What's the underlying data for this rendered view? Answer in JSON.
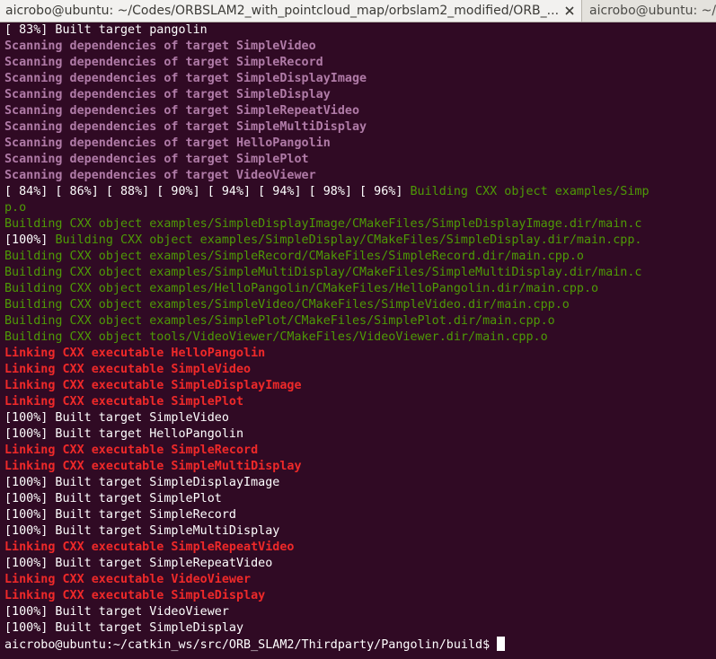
{
  "tabs": [
    {
      "title": "aicrobo@ubuntu: ~/Codes/ORBSLAM2_with_pointcloud_map/orbslam2_modified/ORB_...",
      "active": true
    },
    {
      "title": "aicrobo@ubuntu: ~/c",
      "active": false
    }
  ],
  "colors": {
    "background": "#300a24",
    "white": "#ffffff",
    "magenta": "#b07ba7",
    "green": "#4e9a06",
    "red": "#ef2929"
  },
  "lines": [
    {
      "segments": [
        {
          "text": "[ 83%] Built target pangolin",
          "color": "white"
        }
      ]
    },
    {
      "segments": [
        {
          "text": "Scanning dependencies of target SimpleVideo",
          "color": "magenta"
        }
      ]
    },
    {
      "segments": [
        {
          "text": "Scanning dependencies of target SimpleRecord",
          "color": "magenta"
        }
      ]
    },
    {
      "segments": [
        {
          "text": "Scanning dependencies of target SimpleDisplayImage",
          "color": "magenta"
        }
      ]
    },
    {
      "segments": [
        {
          "text": "Scanning dependencies of target SimpleDisplay",
          "color": "magenta"
        }
      ]
    },
    {
      "segments": [
        {
          "text": "Scanning dependencies of target SimpleRepeatVideo",
          "color": "magenta"
        }
      ]
    },
    {
      "segments": [
        {
          "text": "Scanning dependencies of target SimpleMultiDisplay",
          "color": "magenta"
        }
      ]
    },
    {
      "segments": [
        {
          "text": "Scanning dependencies of target HelloPangolin",
          "color": "magenta"
        }
      ]
    },
    {
      "segments": [
        {
          "text": "Scanning dependencies of target SimplePlot",
          "color": "magenta"
        }
      ]
    },
    {
      "segments": [
        {
          "text": "Scanning dependencies of target VideoViewer",
          "color": "magenta"
        }
      ]
    },
    {
      "segments": [
        {
          "text": "[ 84%] [ 86%] [ 88%] [ 90%] [ 94%] [ 94%] [ 98%] [ 96%] ",
          "color": "white"
        },
        {
          "text": "Building CXX object examples/Simp",
          "color": "green"
        }
      ]
    },
    {
      "segments": [
        {
          "text": "p.o",
          "color": "green"
        }
      ]
    },
    {
      "segments": [
        {
          "text": "Building CXX object examples/SimpleDisplayImage/CMakeFiles/SimpleDisplayImage.dir/main.c",
          "color": "green"
        }
      ]
    },
    {
      "segments": [
        {
          "text": "[100%] ",
          "color": "white"
        },
        {
          "text": "Building CXX object examples/SimpleDisplay/CMakeFiles/SimpleDisplay.dir/main.cpp.",
          "color": "green"
        }
      ]
    },
    {
      "segments": [
        {
          "text": "Building CXX object examples/SimpleRecord/CMakeFiles/SimpleRecord.dir/main.cpp.o",
          "color": "green"
        }
      ]
    },
    {
      "segments": [
        {
          "text": "Building CXX object examples/SimpleMultiDisplay/CMakeFiles/SimpleMultiDisplay.dir/main.c",
          "color": "green"
        }
      ]
    },
    {
      "segments": [
        {
          "text": "Building CXX object examples/HelloPangolin/CMakeFiles/HelloPangolin.dir/main.cpp.o",
          "color": "green"
        }
      ]
    },
    {
      "segments": [
        {
          "text": "Building CXX object examples/SimpleVideo/CMakeFiles/SimpleVideo.dir/main.cpp.o",
          "color": "green"
        }
      ]
    },
    {
      "segments": [
        {
          "text": "Building CXX object examples/SimplePlot/CMakeFiles/SimplePlot.dir/main.cpp.o",
          "color": "green"
        }
      ]
    },
    {
      "segments": [
        {
          "text": "Building CXX object tools/VideoViewer/CMakeFiles/VideoViewer.dir/main.cpp.o",
          "color": "green"
        }
      ]
    },
    {
      "segments": [
        {
          "text": "Linking CXX executable HelloPangolin",
          "color": "red"
        }
      ]
    },
    {
      "segments": [
        {
          "text": "Linking CXX executable SimpleVideo",
          "color": "red"
        }
      ]
    },
    {
      "segments": [
        {
          "text": "Linking CXX executable SimpleDisplayImage",
          "color": "red"
        }
      ]
    },
    {
      "segments": [
        {
          "text": "Linking CXX executable SimplePlot",
          "color": "red"
        }
      ]
    },
    {
      "segments": [
        {
          "text": "[100%] Built target SimpleVideo",
          "color": "white"
        }
      ]
    },
    {
      "segments": [
        {
          "text": "[100%] Built target HelloPangolin",
          "color": "white"
        }
      ]
    },
    {
      "segments": [
        {
          "text": "Linking CXX executable SimpleRecord",
          "color": "red"
        }
      ]
    },
    {
      "segments": [
        {
          "text": "Linking CXX executable SimpleMultiDisplay",
          "color": "red"
        }
      ]
    },
    {
      "segments": [
        {
          "text": "[100%] Built target SimpleDisplayImage",
          "color": "white"
        }
      ]
    },
    {
      "segments": [
        {
          "text": "[100%] Built target SimplePlot",
          "color": "white"
        }
      ]
    },
    {
      "segments": [
        {
          "text": "[100%] Built target SimpleRecord",
          "color": "white"
        }
      ]
    },
    {
      "segments": [
        {
          "text": "[100%] Built target SimpleMultiDisplay",
          "color": "white"
        }
      ]
    },
    {
      "segments": [
        {
          "text": "Linking CXX executable SimpleRepeatVideo",
          "color": "red"
        }
      ]
    },
    {
      "segments": [
        {
          "text": "[100%] Built target SimpleRepeatVideo",
          "color": "white"
        }
      ]
    },
    {
      "segments": [
        {
          "text": "Linking CXX executable VideoViewer",
          "color": "red"
        }
      ]
    },
    {
      "segments": [
        {
          "text": "Linking CXX executable SimpleDisplay",
          "color": "red"
        }
      ]
    },
    {
      "segments": [
        {
          "text": "[100%] Built target VideoViewer",
          "color": "white"
        }
      ]
    },
    {
      "segments": [
        {
          "text": "[100%] Built target SimpleDisplay",
          "color": "white"
        }
      ]
    }
  ],
  "prompt": {
    "text": "aicrobo@ubuntu:~/catkin_ws/src/ORB_SLAM2/Thirdparty/Pangolin/build$ ",
    "color": "white"
  }
}
